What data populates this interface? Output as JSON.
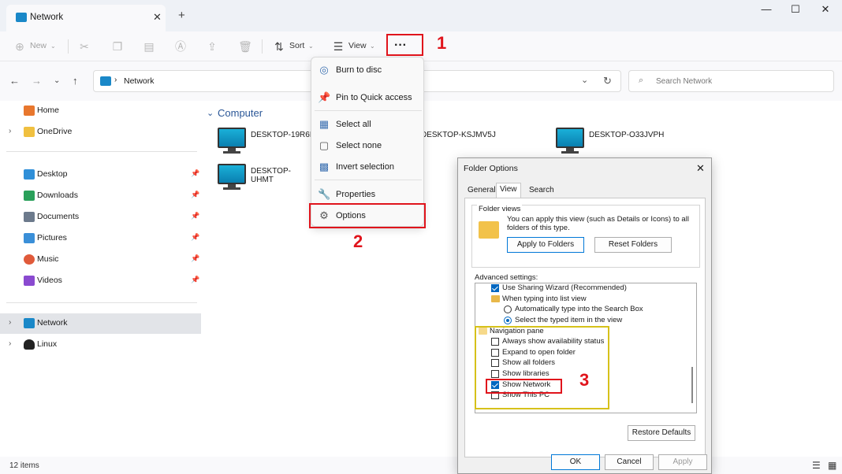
{
  "window": {
    "tab_title": "Network",
    "new_tab": "+",
    "minimize": "—",
    "maximize": "☐",
    "close": "✕"
  },
  "toolbar": {
    "new_label": "New",
    "sort_label": "Sort",
    "view_label": "View",
    "more_label": "···"
  },
  "address": {
    "crumb": "Network",
    "search_placeholder": "Search Network"
  },
  "sidebar": {
    "items": [
      {
        "label": "Home",
        "chevron": false,
        "pin": false,
        "color": "#e8772e"
      },
      {
        "label": "OneDrive",
        "chevron": true,
        "pin": false,
        "color": "#f0c040"
      },
      {
        "label": "Desktop",
        "chevron": false,
        "pin": true,
        "color": "#2f8fd8"
      },
      {
        "label": "Downloads",
        "chevron": false,
        "pin": true,
        "color": "#2aa05a"
      },
      {
        "label": "Documents",
        "chevron": false,
        "pin": true,
        "color": "#6c7a8c"
      },
      {
        "label": "Pictures",
        "chevron": false,
        "pin": true,
        "color": "#3a8fd8"
      },
      {
        "label": "Music",
        "chevron": false,
        "pin": true,
        "color": "#e05a3a"
      },
      {
        "label": "Videos",
        "chevron": false,
        "pin": true,
        "color": "#8a4ad0"
      },
      {
        "label": "Network",
        "chevron": true,
        "pin": false,
        "color": "#1a88c8"
      },
      {
        "label": "Linux",
        "chevron": true,
        "pin": false,
        "color": "#222222"
      }
    ]
  },
  "main": {
    "group_label": "Computer",
    "computers": [
      "DESKTOP-19R6M",
      "DESKTOP-KSJMV5J",
      "DESKTOP-O33JVPH",
      "DESKTOP-UHMT"
    ]
  },
  "menu": {
    "items": [
      {
        "label": "Burn to disc",
        "icon": "disc-icon"
      },
      {
        "label": "Pin to Quick access",
        "icon": "pin-icon"
      },
      {
        "label": "Select all",
        "icon": "select-all-icon"
      },
      {
        "label": "Select none",
        "icon": "select-none-icon"
      },
      {
        "label": "Invert selection",
        "icon": "invert-selection-icon"
      },
      {
        "label": "Properties",
        "icon": "properties-icon"
      },
      {
        "label": "Options",
        "icon": "gear-icon"
      }
    ]
  },
  "annotations": {
    "step1": "1",
    "step2": "2",
    "step3": "3"
  },
  "dialog": {
    "title": "Folder Options",
    "tabs": [
      "General",
      "View",
      "Search"
    ],
    "folder_views_legend": "Folder views",
    "folder_views_text": "You can apply this view (such as Details or Icons) to all folders of this type.",
    "apply_to_folders": "Apply to Folders",
    "reset_folders": "Reset Folders",
    "advanced_label": "Advanced settings:",
    "tree": [
      {
        "kind": "check",
        "checked": true,
        "indent": 20,
        "label": "Use Sharing Wizard (Recommended)"
      },
      {
        "kind": "folder",
        "indent": 20,
        "label": "When typing into list view"
      },
      {
        "kind": "radio",
        "checked": false,
        "indent": 36,
        "label": "Automatically type into the Search Box"
      },
      {
        "kind": "radio",
        "checked": true,
        "indent": 36,
        "label": "Select the typed item in the view"
      },
      {
        "kind": "folder",
        "indent": 4,
        "label": "Navigation pane"
      },
      {
        "kind": "check",
        "checked": false,
        "indent": 20,
        "label": "Always show availability status"
      },
      {
        "kind": "check",
        "checked": false,
        "indent": 20,
        "label": "Expand to open folder"
      },
      {
        "kind": "check",
        "checked": false,
        "indent": 20,
        "label": "Show all folders"
      },
      {
        "kind": "check",
        "checked": false,
        "indent": 20,
        "label": "Show libraries"
      },
      {
        "kind": "check",
        "checked": true,
        "indent": 20,
        "label": "Show Network"
      },
      {
        "kind": "check",
        "checked": false,
        "indent": 20,
        "label": "Show This PC"
      }
    ],
    "restore_defaults": "Restore Defaults",
    "ok": "OK",
    "cancel": "Cancel",
    "apply": "Apply"
  },
  "status": {
    "item_count": "12 items"
  },
  "colors": {
    "accent": "#0067c0",
    "annotation_red": "#e0141c",
    "annotation_yellow": "#d6c11a"
  }
}
